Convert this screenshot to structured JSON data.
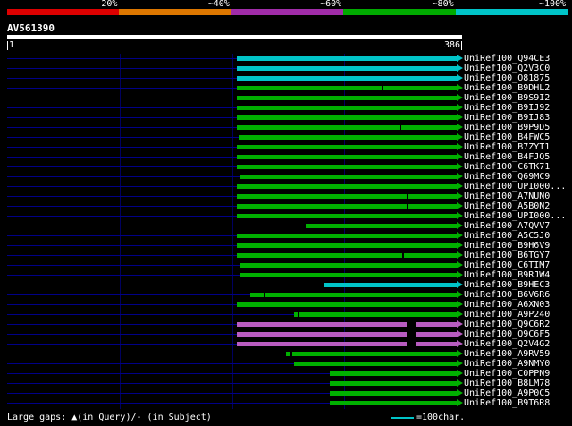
{
  "title": "AV561390",
  "scale_bar": {
    "labels": [
      "20%",
      "~40%",
      "~60%",
      "~80%",
      "~100%"
    ],
    "colors": [
      "#dd0000",
      "#dd7700",
      "#a02ca8",
      "#00aa00",
      "#00c4c8"
    ]
  },
  "ruler": {
    "start": "1",
    "end": "386"
  },
  "identity_colors": {
    "cyan": "#00c4c8",
    "green": "#00b000",
    "purple": "#b85cc0"
  },
  "legend": {
    "gaps_text": "Large gaps: ▲(in Query)/- (in Subject)",
    "scale_text": "=100char.",
    "scale_color": "#00c4c8"
  },
  "chart_data": {
    "type": "bar",
    "title": "AV561390",
    "xlabel": "query position",
    "x_range": [
      1,
      386
    ],
    "identity_legend": [
      {
        "label": "20%",
        "color": "#dd0000"
      },
      {
        "label": "~40%",
        "color": "#dd7700"
      },
      {
        "label": "~60%",
        "color": "#a02ca8"
      },
      {
        "label": "~80%",
        "color": "#00aa00"
      },
      {
        "label": "~100%",
        "color": "#00c4c8"
      }
    ],
    "hits": [
      {
        "label": "UniRef100_Q94CE3",
        "band": "cyan",
        "identity": "~100%",
        "start": 198,
        "end": 386
      },
      {
        "label": "UniRef100_Q2V3C0",
        "band": "cyan",
        "identity": "~100%",
        "start": 198,
        "end": 386
      },
      {
        "label": "UniRef100_O81875",
        "band": "cyan",
        "identity": "~100%",
        "start": 198,
        "end": 386
      },
      {
        "label": "UniRef100_B9DHL2",
        "band": "green",
        "identity": "~80%",
        "start": 198,
        "end": 386,
        "ticks": [
          322
        ]
      },
      {
        "label": "UniRef100_B9S9I2",
        "band": "green",
        "identity": "~80%",
        "start": 198,
        "end": 386
      },
      {
        "label": "UniRef100_B9IJ92",
        "band": "green",
        "identity": "~80%",
        "start": 198,
        "end": 386
      },
      {
        "label": "UniRef100_B9IJ83",
        "band": "green",
        "identity": "~80%",
        "start": 198,
        "end": 386
      },
      {
        "label": "UniRef100_B9P9D5",
        "band": "green",
        "identity": "~80%",
        "start": 198,
        "end": 386,
        "ticks": [
          337
        ]
      },
      {
        "label": "UniRef100_B4FWC5",
        "band": "green",
        "identity": "~80%",
        "start": 199,
        "end": 386
      },
      {
        "label": "UniRef100_B7ZYT1",
        "band": "green",
        "identity": "~80%",
        "start": 198,
        "end": 386
      },
      {
        "label": "UniRef100_B4FJQ5",
        "band": "green",
        "identity": "~80%",
        "start": 198,
        "end": 386
      },
      {
        "label": "UniRef100_C6TK71",
        "band": "green",
        "identity": "~80%",
        "start": 198,
        "end": 386
      },
      {
        "label": "UniRef100_Q69MC9",
        "band": "green",
        "identity": "~80%",
        "start": 201,
        "end": 386
      },
      {
        "label": "UniRef100_UPI000...",
        "band": "green",
        "identity": "~80%",
        "start": 198,
        "end": 386
      },
      {
        "label": "UniRef100_A7NUN0",
        "band": "green",
        "identity": "~80%",
        "start": 198,
        "end": 386,
        "ticks": [
          343
        ]
      },
      {
        "label": "UniRef100_A5B0N2",
        "band": "green",
        "identity": "~80%",
        "start": 198,
        "end": 386,
        "ticks": [
          343
        ]
      },
      {
        "label": "UniRef100_UPI000...",
        "band": "green",
        "identity": "~80%",
        "start": 198,
        "end": 386
      },
      {
        "label": "UniRef100_A7QVV7",
        "band": "green",
        "identity": "~80%",
        "start": 257,
        "end": 386
      },
      {
        "label": "UniRef100_A5C5J0",
        "band": "green",
        "identity": "~80%",
        "start": 198,
        "end": 386
      },
      {
        "label": "UniRef100_B9H6V9",
        "band": "green",
        "identity": "~80%",
        "start": 198,
        "end": 386
      },
      {
        "label": "UniRef100_B6TGY7",
        "band": "green",
        "identity": "~80%",
        "start": 198,
        "end": 386,
        "ticks": [
          339
        ]
      },
      {
        "label": "UniRef100_C6TIM7",
        "band": "green",
        "identity": "~80%",
        "start": 201,
        "end": 386
      },
      {
        "label": "UniRef100_B9RJW4",
        "band": "green",
        "identity": "~80%",
        "start": 201,
        "end": 386
      },
      {
        "label": "UniRef100_B9HEC3",
        "band": "cyan",
        "identity": "~100%",
        "start": 273,
        "end": 386
      },
      {
        "label": "UniRef100_B6V6R6",
        "band": "green",
        "identity": "~80%",
        "start": 209,
        "end": 386,
        "ticks": [
          221
        ]
      },
      {
        "label": "UniRef100_A6XN03",
        "band": "green",
        "identity": "~80%",
        "start": 198,
        "end": 386
      },
      {
        "label": "UniRef100_A9P240",
        "band": "green",
        "identity": "~80%",
        "start": 247,
        "end": 386,
        "ticks": [
          250
        ]
      },
      {
        "label": "UniRef100_Q9C6R2",
        "band": "purple",
        "identity": "~60%",
        "start": 198,
        "end": 386,
        "gaps": [
          [
            343,
            351
          ]
        ]
      },
      {
        "label": "UniRef100_Q9C6F5",
        "band": "purple",
        "identity": "~60%",
        "start": 198,
        "end": 386,
        "gaps": [
          [
            343,
            351
          ]
        ]
      },
      {
        "label": "UniRef100_Q2V4G2",
        "band": "purple",
        "identity": "~60%",
        "start": 198,
        "end": 386,
        "gaps": [
          [
            343,
            351
          ]
        ]
      },
      {
        "label": "UniRef100_A9RV59",
        "band": "green",
        "identity": "~80%",
        "start": 240,
        "end": 386,
        "ticks": [
          244
        ]
      },
      {
        "label": "UniRef100_A9NMY0",
        "band": "green",
        "identity": "~80%",
        "start": 247,
        "end": 386
      },
      {
        "label": "UniRef100_C0PPN9",
        "band": "green",
        "identity": "~80%",
        "start": 277,
        "end": 386
      },
      {
        "label": "UniRef100_B8LM78",
        "band": "green",
        "identity": "~80%",
        "start": 277,
        "end": 386
      },
      {
        "label": "UniRef100_A9P0C5",
        "band": "green",
        "identity": "~80%",
        "start": 277,
        "end": 386
      },
      {
        "label": "UniRef100_B9T6R8",
        "band": "green",
        "identity": "~80%",
        "start": 277,
        "end": 386
      }
    ]
  }
}
